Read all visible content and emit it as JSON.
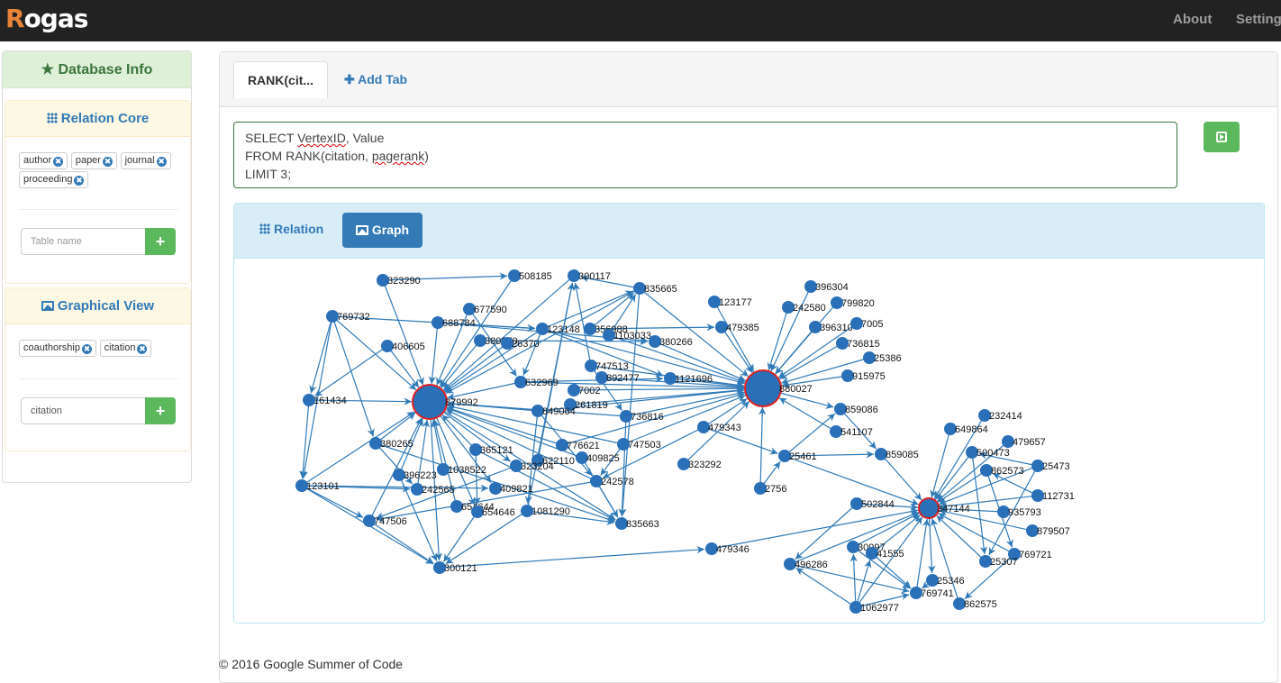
{
  "app": {
    "logo": "Rogas",
    "nav": [
      "About",
      "Setting"
    ]
  },
  "sidebar": {
    "title": "Database Info",
    "relation_core": {
      "title": "Relation Core",
      "tags": [
        "author",
        "paper",
        "journal",
        "proceeding"
      ],
      "input_placeholder": "Table name",
      "input_value": "",
      "add_label": "+"
    },
    "graphical_view": {
      "title": "Graphical View",
      "tags": [
        "coauthorship",
        "citation"
      ],
      "input_placeholder": "",
      "input_value": "citation",
      "add_label": "+"
    }
  },
  "tabs": {
    "active": "RANK(cit...",
    "add": "Add Tab"
  },
  "query": {
    "line1_a": "SELECT ",
    "line1_b": "VertexID",
    "line1_c": ", Value",
    "line2_a": "FROM RANK(citation, ",
    "line2_b": "pagerank",
    "line2_c": ")",
    "line3": "LIMIT 3;"
  },
  "result_tabs": {
    "relation": "Relation",
    "graph": "Graph",
    "active": "Graph"
  },
  "colors": {
    "node": "#2a70b8",
    "hub_border": "#e02020",
    "edge": "#2f7ab8",
    "success": "#5cb85c",
    "primary": "#337ab7"
  },
  "graph": {
    "highlighted": [
      "879992",
      "880027",
      "347144"
    ],
    "nodes": [
      "323290",
      "508185",
      "300117",
      "835665",
      "123177",
      "396304",
      "242580",
      "799820",
      "396310",
      "7005",
      "736815",
      "25386",
      "915975",
      "677590",
      "769732",
      "688784",
      "123148",
      "356988",
      "1103033",
      "380266",
      "479385",
      "406605",
      "380270",
      "26370",
      "747513",
      "892477",
      "1121696",
      "632969",
      "7002",
      "261819",
      "879992",
      "880027",
      "161434",
      "849064",
      "736816",
      "859086",
      "479343",
      "541107",
      "380265",
      "776621",
      "747503",
      "365121",
      "409825",
      "25461",
      "859085",
      "622110",
      "323292",
      "323204",
      "1038522",
      "396223",
      "242578",
      "123101",
      "242565",
      "409821",
      "2756",
      "654644",
      "654646",
      "1081290",
      "747506",
      "835663",
      "300121",
      "479346",
      "232414",
      "649864",
      "479657",
      "500473",
      "862573",
      "25473",
      "112731",
      "502844",
      "347144",
      "935793",
      "879507",
      "769721",
      "25307",
      "30997",
      "41555",
      "496286",
      "25346",
      "769741",
      "862575",
      "1062977"
    ],
    "edges": [
      [
        "323290",
        "879992"
      ],
      [
        "769732",
        "879992"
      ],
      [
        "688784",
        "879992"
      ],
      [
        "406605",
        "879992"
      ],
      [
        "677590",
        "879992"
      ],
      [
        "161434",
        "879992"
      ],
      [
        "380265",
        "879992"
      ],
      [
        "365121",
        "879992"
      ],
      [
        "396223",
        "879992"
      ],
      [
        "242565",
        "879992"
      ],
      [
        "1038522",
        "879992"
      ],
      [
        "747506",
        "879992"
      ],
      [
        "123101",
        "879992"
      ],
      [
        "654644",
        "879992"
      ],
      [
        "849064",
        "879992"
      ],
      [
        "632969",
        "879992"
      ],
      [
        "123148",
        "879992"
      ],
      [
        "508185",
        "879992"
      ],
      [
        "300117",
        "879992"
      ],
      [
        "835665",
        "879992"
      ],
      [
        "776621",
        "879992"
      ],
      [
        "747503",
        "879992"
      ],
      [
        "736816",
        "879992"
      ],
      [
        "409825",
        "879992"
      ],
      [
        "242578",
        "879992"
      ],
      [
        "380270",
        "879992"
      ],
      [
        "26370",
        "879992"
      ],
      [
        "879992",
        "300121"
      ],
      [
        "879992",
        "835663"
      ],
      [
        "879992",
        "409821"
      ],
      [
        "879992",
        "323204"
      ],
      [
        "879992",
        "654646"
      ],
      [
        "123177",
        "880027"
      ],
      [
        "479385",
        "880027"
      ],
      [
        "396304",
        "880027"
      ],
      [
        "242580",
        "880027"
      ],
      [
        "799820",
        "880027"
      ],
      [
        "396310",
        "880027"
      ],
      [
        "7005",
        "880027"
      ],
      [
        "736815",
        "880027"
      ],
      [
        "25386",
        "880027"
      ],
      [
        "915975",
        "880027"
      ],
      [
        "541107",
        "880027"
      ],
      [
        "2756",
        "880027"
      ],
      [
        "479343",
        "880027"
      ],
      [
        "1121696",
        "880027"
      ],
      [
        "7002",
        "880027"
      ],
      [
        "261819",
        "880027"
      ],
      [
        "736816",
        "880027"
      ],
      [
        "849064",
        "880027"
      ],
      [
        "747513",
        "880027"
      ],
      [
        "892477",
        "880027"
      ],
      [
        "1103033",
        "880027"
      ],
      [
        "123148",
        "880027"
      ],
      [
        "380266",
        "880027"
      ],
      [
        "632969",
        "880027"
      ],
      [
        "323292",
        "880027"
      ],
      [
        "776621",
        "880027"
      ],
      [
        "747503",
        "880027"
      ],
      [
        "835665",
        "880027"
      ],
      [
        "880027",
        "859086"
      ],
      [
        "649864",
        "347144"
      ],
      [
        "232414",
        "347144"
      ],
      [
        "479657",
        "347144"
      ],
      [
        "500473",
        "347144"
      ],
      [
        "862573",
        "347144"
      ],
      [
        "25473",
        "347144"
      ],
      [
        "112731",
        "347144"
      ],
      [
        "935793",
        "347144"
      ],
      [
        "879507",
        "347144"
      ],
      [
        "769721",
        "347144"
      ],
      [
        "25307",
        "347144"
      ],
      [
        "502844",
        "347144"
      ],
      [
        "859085",
        "347144"
      ],
      [
        "25461",
        "347144"
      ],
      [
        "479346",
        "347144"
      ],
      [
        "496286",
        "347144"
      ],
      [
        "30997",
        "347144"
      ],
      [
        "41555",
        "347144"
      ],
      [
        "769741",
        "347144"
      ],
      [
        "1062977",
        "347144"
      ],
      [
        "862575",
        "347144"
      ],
      [
        "347144",
        "25346"
      ],
      [
        "323290",
        "508185"
      ],
      [
        "769732",
        "161434"
      ],
      [
        "769732",
        "123101"
      ],
      [
        "161434",
        "123101"
      ],
      [
        "688784",
        "123148"
      ],
      [
        "769732",
        "123148"
      ],
      [
        "835665",
        "300117"
      ],
      [
        "835665",
        "835663"
      ],
      [
        "123148",
        "835665"
      ],
      [
        "356988",
        "479385"
      ],
      [
        "1103033",
        "835665"
      ],
      [
        "747513",
        "300117"
      ],
      [
        "859086",
        "859085"
      ],
      [
        "25461",
        "859085"
      ],
      [
        "25461",
        "859086"
      ],
      [
        "2756",
        "25461"
      ],
      [
        "479343",
        "25461"
      ],
      [
        "123101",
        "747506"
      ],
      [
        "747506",
        "300121"
      ],
      [
        "123101",
        "300121"
      ],
      [
        "380265",
        "835663"
      ],
      [
        "365121",
        "835663"
      ],
      [
        "409825",
        "835663"
      ],
      [
        "242578",
        "835663"
      ],
      [
        "1081290",
        "835663"
      ],
      [
        "654646",
        "300121"
      ],
      [
        "1081290",
        "300121"
      ],
      [
        "622110",
        "300117"
      ],
      [
        "849064",
        "1081290"
      ],
      [
        "736816",
        "835663"
      ],
      [
        "747503",
        "242578"
      ],
      [
        "479343",
        "242578"
      ],
      [
        "123101",
        "409821"
      ],
      [
        "123101",
        "242565"
      ],
      [
        "406605",
        "161434"
      ],
      [
        "769732",
        "380265"
      ],
      [
        "300121",
        "479346"
      ],
      [
        "1062977",
        "496286"
      ],
      [
        "1062977",
        "30997"
      ],
      [
        "1062977",
        "769741"
      ],
      [
        "496286",
        "769741"
      ],
      [
        "30997",
        "769741"
      ],
      [
        "41555",
        "769741"
      ],
      [
        "25346",
        "769741"
      ],
      [
        "502844",
        "496286"
      ],
      [
        "112731",
        "862573"
      ],
      [
        "25473",
        "25307"
      ],
      [
        "500473",
        "25307"
      ],
      [
        "769721",
        "862575"
      ],
      [
        "862573",
        "769721"
      ],
      [
        "25473",
        "500473"
      ],
      [
        "1062977",
        "41555"
      ],
      [
        "688784",
        "380266"
      ],
      [
        "380270",
        "380266"
      ],
      [
        "123148",
        "1121696"
      ],
      [
        "356988",
        "835665"
      ],
      [
        "632969",
        "1121696"
      ],
      [
        "677590",
        "632969"
      ],
      [
        "380265",
        "242565"
      ],
      [
        "323204",
        "747506"
      ],
      [
        "242578",
        "747506"
      ],
      [
        "1081290",
        "300117"
      ],
      [
        "849064",
        "242578"
      ],
      [
        "396223",
        "300121"
      ],
      [
        "365121",
        "654646"
      ],
      [
        "747513",
        "736816"
      ],
      [
        "123148",
        "632969"
      ]
    ]
  },
  "footer": "© 2016 Google Summer of Code"
}
